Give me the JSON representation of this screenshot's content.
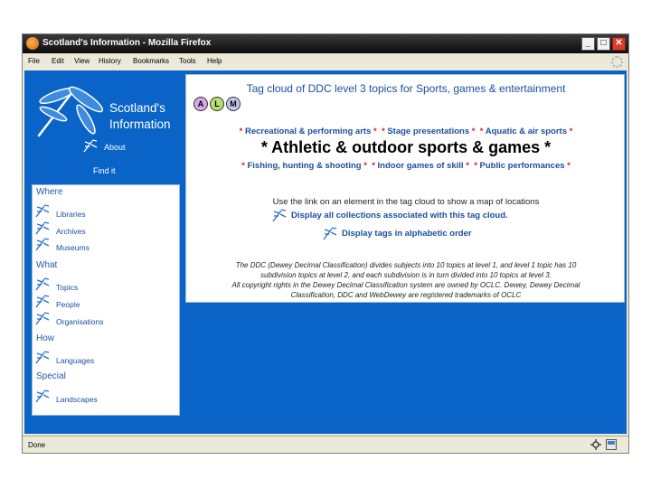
{
  "window": {
    "title": "Scotland's Information - Mozilla Firefox",
    "minimize": "_",
    "maximize": "□",
    "close": "✕"
  },
  "menu": [
    "File",
    "Edit",
    "View",
    "History",
    "Bookmarks",
    "Tools",
    "Help"
  ],
  "sidebar": {
    "site_title_line1": "Scotland's",
    "site_title_line2": "Information",
    "about": "About",
    "find_it": "Find it",
    "sections": [
      {
        "heading": "Where",
        "items": [
          "Libraries",
          "Archives",
          "Museums"
        ]
      },
      {
        "heading": "What",
        "items": [
          "Topics",
          "People",
          "Organisations"
        ]
      },
      {
        "heading": "How",
        "items": [
          "Languages"
        ]
      },
      {
        "heading": "Special",
        "items": [
          "Landscapes"
        ]
      }
    ]
  },
  "main": {
    "cloud_title": "Tag cloud of DDC level 3 topics for Sports, games & entertainment",
    "circles": [
      "A",
      "L",
      "M"
    ],
    "tags_row1": [
      "Recreational & performing arts",
      "Stage presentations",
      "Aquatic & air sports"
    ],
    "tag_big": "* Athletic & outdoor sports & games *",
    "tags_row3": [
      "Fishing, hunting & shooting",
      "Indoor games of skill",
      "Public performances"
    ],
    "hint": "Use the link on an element in the tag cloud to show a map of locations",
    "action_collections": "Display all collections associated with this tag cloud.",
    "action_alpha": "Display tags in alphabetic order",
    "footnote_line1": "The DDC (Dewey Decimal Classification) divides subjects into 10 topics at level 1, and level 1 topic has 10",
    "footnote_line2": "subdivision topics at level 2, and each subdivision is in turn divided into 10 topics at level 3.",
    "footnote_line3": "All copyright rights in the Dewey Decimal Classification system are owned by OCLC. Dewey, Dewey Decimal",
    "footnote_line4": "Classification, DDC and WebDewey are registered trademarks of OCLC"
  },
  "status": {
    "text": "Done"
  },
  "colors": {
    "page_blue": "#0a64c8",
    "link_blue": "#1a4fa0",
    "highlight_red": "#e0201c",
    "circle_a": "#d8a8e8",
    "circle_l": "#b8e070",
    "circle_m": "#c8c8ec"
  },
  "icons": [
    "firefox-icon",
    "dragonfly-logo-icon",
    "dragonfly-icon",
    "throbber-icon",
    "gear-icon",
    "popup-icon"
  ]
}
